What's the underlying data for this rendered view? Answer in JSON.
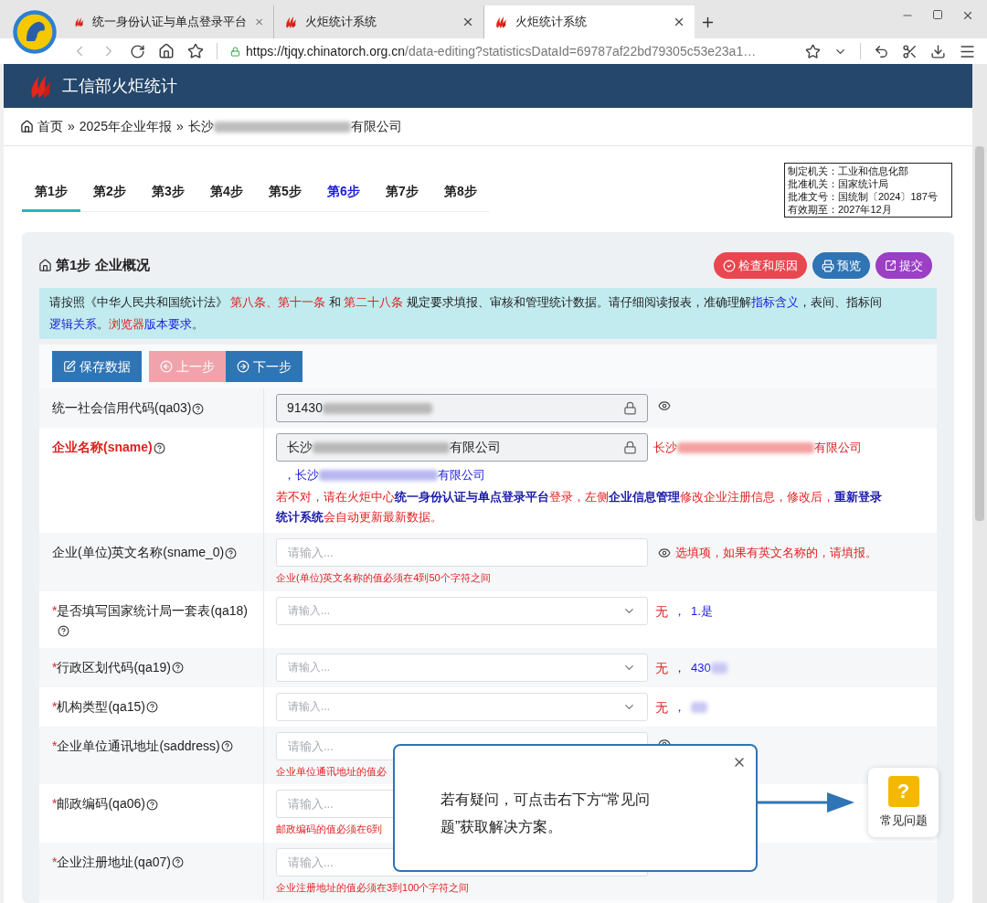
{
  "browser": {
    "tabs": [
      {
        "title": "统一身份认证与单点登录平台",
        "selected": false
      },
      {
        "title": "火炬统计系统",
        "selected": false
      },
      {
        "title": "火炬统计系统",
        "selected": true
      }
    ],
    "url": {
      "host": "https://tjqy.chinatorch.org.cn",
      "path": "/data-editing?statisticsDataId=69787af22bd79305c53e23a1…"
    }
  },
  "app_header": {
    "title": "工信部火炬统计"
  },
  "breadcrumb": [
    {
      "label": "首页"
    },
    {
      "separator": "»",
      "label": "2025年企业年报"
    },
    {
      "separator": "»",
      "prefix": "长沙",
      "suffix": "有限公司"
    }
  ],
  "steps": [
    {
      "label": "第1步",
      "selected": true,
      "highlighted": false
    },
    {
      "label": "第2步",
      "selected": false,
      "highlighted": false
    },
    {
      "label": "第3步",
      "selected": false,
      "highlighted": false
    },
    {
      "label": "第4步",
      "selected": false,
      "highlighted": false
    },
    {
      "label": "第5步",
      "selected": false,
      "highlighted": false
    },
    {
      "label": "第6步",
      "selected": false,
      "highlighted": true
    },
    {
      "label": "第7步",
      "selected": false,
      "highlighted": false
    },
    {
      "label": "第8步",
      "selected": false,
      "highlighted": false
    }
  ],
  "approval_box": [
    "制定机关：工业和信息化部",
    "批准机关：国家统计局",
    "批准文号：国统制〔2024〕187号",
    "有效期至：2027年12月"
  ],
  "section": {
    "title": "第1步 企业概况",
    "actions": [
      {
        "kind": "check",
        "label": "检查和原因"
      },
      {
        "kind": "preview",
        "label": "预览"
      },
      {
        "kind": "submit",
        "label": "提交"
      }
    ]
  },
  "notice": [
    {
      "text": "请按照《中华人民共和国统计法》 ",
      "kind": "plain"
    },
    {
      "text": "第八条、第十一条",
      "kind": "emphasis"
    },
    {
      "text": " 和 ",
      "kind": "plain"
    },
    {
      "text": "第二十八条",
      "kind": "emphasis"
    },
    {
      "text": " 规定要求填报、审核和管理统计数据。请仔细阅读报表，准确理解",
      "kind": "plain"
    },
    {
      "text": "指标含义",
      "kind": "link"
    },
    {
      "text": "，表间、指标间",
      "kind": "plain"
    },
    {
      "text": "逻辑关系",
      "kind": "link"
    },
    {
      "text": "。",
      "kind": "plain"
    },
    {
      "text": "浏览器",
      "kind": "emphasis"
    },
    {
      "text": "版本要求",
      "kind": "link"
    },
    {
      "text": "。",
      "kind": "plain"
    }
  ],
  "toolbar": [
    {
      "kind": "save",
      "label": "保存数据",
      "disabled": false
    },
    {
      "kind": "prev",
      "label": "上一步",
      "disabled": true
    },
    {
      "kind": "next",
      "label": "下一步",
      "disabled": false
    }
  ],
  "fields": [
    {
      "kind": "locked",
      "label": "统一社会信用代码(qa03)",
      "emphasized": false,
      "value": {
        "prefix": "91430"
      },
      "eye": true
    },
    {
      "kind": "locked",
      "label": "企业名称(sname)",
      "emphasized": true,
      "value": {
        "prefix": "长沙",
        "suffix": "有限公司"
      },
      "eye": false,
      "side_value": {
        "prefix": "长沙",
        "suffix": "有限公司"
      },
      "second_value": {
        "prefix": "，长沙",
        "suffix": "有限公司"
      },
      "message": [
        {
          "text": "若不对，请在火炬中心",
          "kind": "warning"
        },
        {
          "text": "统一身份认证与单点登录平台",
          "kind": "link"
        },
        {
          "text": "登录，左侧",
          "kind": "warning"
        },
        {
          "text": "企业信息管理",
          "kind": "link"
        },
        {
          "text": "修改企业注册信息，修改后，",
          "kind": "warning"
        },
        {
          "text": "重新登录统计系统",
          "kind": "link"
        },
        {
          "text": "会自动更新最新数据。",
          "kind": "warning"
        }
      ]
    },
    {
      "kind": "text",
      "label": "企业(单位)英文名称(sname_0)",
      "emphasized": false,
      "placeholder": "请输入...",
      "eye": true,
      "note": "选填项，如果有英文名称的，请填报。",
      "hint": "企业(单位)英文名称的值必须在4到50个字符之间"
    },
    {
      "kind": "select",
      "required_mark": "*",
      "label": "是否填写国家统计局一套表(qa18)",
      "emphasized": false,
      "placeholder": "请输入...",
      "eye": false,
      "current": "无",
      "sep": "，",
      "reference": {
        "prefix": "1.是",
        "redacted": false
      }
    },
    {
      "kind": "select",
      "required_mark": "*",
      "label": "行政区划代码(qa19)",
      "emphasized": false,
      "placeholder": "请输入...",
      "eye": false,
      "current": "无",
      "sep": "，",
      "reference": {
        "prefix": "430",
        "redacted": true
      }
    },
    {
      "kind": "select",
      "required_mark": "*",
      "label": "机构类型(qa15)",
      "emphasized": false,
      "placeholder": "请输入...",
      "eye": false,
      "current": "无",
      "sep": "，",
      "reference": {
        "redacted": true
      }
    },
    {
      "kind": "text",
      "required_mark": "*",
      "label": "企业单位通讯地址(saddress)",
      "emphasized": false,
      "placeholder": "请输入...",
      "eye": true,
      "hint": "企业单位通讯地址的值必"
    },
    {
      "kind": "text",
      "required_mark": "*",
      "label": "邮政编码(qa06)",
      "emphasized": false,
      "placeholder": "请输入...",
      "eye": false,
      "hint": "邮政编码的值必须在6到"
    },
    {
      "kind": "text",
      "required_mark": "*",
      "label": "企业注册地址(qa07)",
      "emphasized": false,
      "placeholder": "请输入...",
      "eye": false,
      "hint": "企业注册地址的值必须在3到100个字符之间"
    }
  ],
  "tip_popup": {
    "text": "若有疑问，可点击右下方“常见问题”获取解决方案。"
  },
  "faq_button": {
    "label": "常见问题",
    "icon_text": "?"
  }
}
